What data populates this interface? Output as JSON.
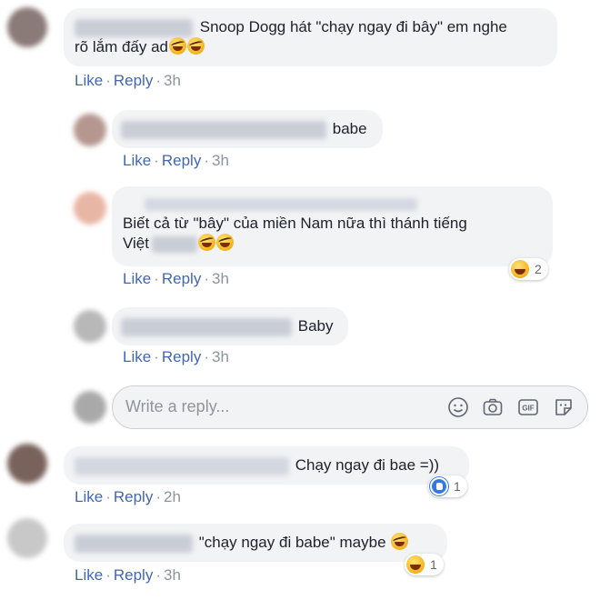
{
  "actions": {
    "like": "Like",
    "reply": "Reply",
    "separator": "·"
  },
  "comments": [
    {
      "text_line1": "Snoop Dogg hát \"chạy ngay đi bây\" em nghe",
      "text_line2": "rõ lắm đấy ad",
      "time": "3h"
    },
    {
      "text": "babe",
      "time": "3h"
    },
    {
      "text_line1": "Biết cả từ \"bây\" của miền Nam nữa thì thánh tiếng",
      "text_line2": "Việt",
      "time": "3h",
      "reaction_count": "2"
    },
    {
      "text": "Baby",
      "time": "3h"
    },
    {
      "text": "Chạy ngay đi bae =))",
      "time": "2h",
      "reaction_count": "1"
    },
    {
      "text": "\"chạy ngay đi babe\" maybe",
      "time": "3h",
      "reaction_count": "1"
    }
  ],
  "reply_input": {
    "placeholder": "Write a reply..."
  },
  "icons": [
    "emoji-icon",
    "camera-icon",
    "gif-icon",
    "sticker-icon",
    "haha-reaction-icon",
    "like-reaction-icon"
  ],
  "colors": {
    "link": "#4267b2",
    "bubble": "#f2f3f5",
    "meta": "#8d949e"
  }
}
